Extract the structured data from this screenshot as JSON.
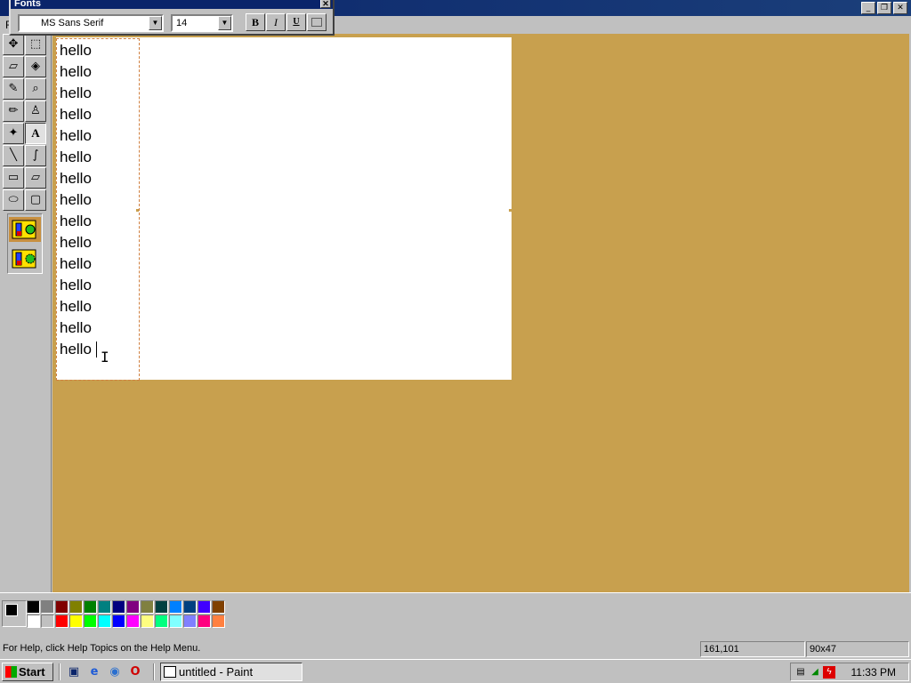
{
  "window": {
    "menu_first_letter": "F",
    "minimize": "_",
    "maximize": "❐",
    "close": "✕"
  },
  "fonts_toolbar": {
    "title": "Fonts",
    "close": "✕",
    "font_name": "MS Sans Serif",
    "font_size": "14",
    "bold": "B",
    "italic": "I",
    "underline": "U"
  },
  "tools": [
    {
      "name": "free-form-select",
      "glyph": "✥"
    },
    {
      "name": "select",
      "glyph": "⬚"
    },
    {
      "name": "eraser",
      "glyph": "▱"
    },
    {
      "name": "fill-with-color",
      "glyph": "◈"
    },
    {
      "name": "pick-color",
      "glyph": "✎"
    },
    {
      "name": "magnifier",
      "glyph": "⌕"
    },
    {
      "name": "pencil",
      "glyph": "✏"
    },
    {
      "name": "brush",
      "glyph": "♙"
    },
    {
      "name": "airbrush",
      "glyph": "✦"
    },
    {
      "name": "text",
      "glyph": "A"
    },
    {
      "name": "line",
      "glyph": "╲"
    },
    {
      "name": "curve",
      "glyph": "∫"
    },
    {
      "name": "rectangle",
      "glyph": "▭"
    },
    {
      "name": "polygon",
      "glyph": "▱"
    },
    {
      "name": "ellipse",
      "glyph": "⬭"
    },
    {
      "name": "rounded-rectangle",
      "glyph": "▢"
    }
  ],
  "canvas": {
    "lines": [
      "hello",
      "hello",
      "hello",
      "hello",
      "hello",
      "hello",
      "hello",
      "hello",
      "hello",
      "hello",
      "hello",
      "hello",
      "hello",
      "hello",
      "hello"
    ]
  },
  "palette": {
    "foreground": "#000000",
    "background": "#ffffff",
    "row1": [
      "#000000",
      "#808080",
      "#800000",
      "#808000",
      "#008000",
      "#008080",
      "#000080",
      "#800080",
      "#808040",
      "#004040",
      "#0080ff",
      "#004080",
      "#4000ff",
      "#804000"
    ],
    "row2": [
      "#ffffff",
      "#c0c0c0",
      "#ff0000",
      "#ffff00",
      "#00ff00",
      "#00ffff",
      "#0000ff",
      "#ff00ff",
      "#ffff80",
      "#00ff80",
      "#80ffff",
      "#8080ff",
      "#ff0080",
      "#ff8040"
    ]
  },
  "status": {
    "help": "For Help, click Help Topics on the Help Menu.",
    "position": "161,101",
    "size": "90x47"
  },
  "taskbar": {
    "start": "Start",
    "quick_launch": [
      {
        "name": "show-desktop-icon",
        "glyph": "▣",
        "color": "#0a246a"
      },
      {
        "name": "internet-explorer-icon",
        "glyph": "e",
        "color": "#1e5bd6"
      },
      {
        "name": "channels-icon",
        "glyph": "◉",
        "color": "#2a6fcf"
      },
      {
        "name": "opera-icon",
        "glyph": "O",
        "color": "#d00000"
      }
    ],
    "task_title": "untitled - Paint",
    "clock": "11:33 PM"
  }
}
